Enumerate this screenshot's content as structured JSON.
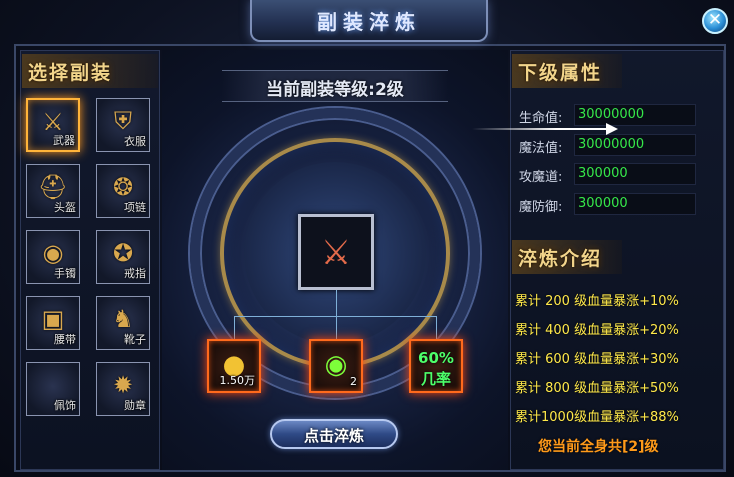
{
  "title": "副装淬炼",
  "close_icon": "close-icon",
  "left_panel": {
    "header": "选择副装",
    "slots": [
      {
        "label": "武器",
        "icon": "sword-icon",
        "glyph": "⚔",
        "selected": true
      },
      {
        "label": "衣服",
        "icon": "armor-icon",
        "glyph": "⛨",
        "selected": false
      },
      {
        "label": "头盔",
        "icon": "helmet-icon",
        "glyph": "⛑",
        "selected": false
      },
      {
        "label": "项链",
        "icon": "necklace-icon",
        "glyph": "❂",
        "selected": false
      },
      {
        "label": "手镯",
        "icon": "bracelet-icon",
        "glyph": "◉",
        "selected": false
      },
      {
        "label": "戒指",
        "icon": "ring-icon",
        "glyph": "✪",
        "selected": false
      },
      {
        "label": "腰带",
        "icon": "belt-icon",
        "glyph": "▣",
        "selected": false
      },
      {
        "label": "靴子",
        "icon": "boots-icon",
        "glyph": "♞",
        "selected": false
      },
      {
        "label": "佩饰",
        "icon": "accessory-icon",
        "glyph": "",
        "selected": false
      },
      {
        "label": "勋章",
        "icon": "medal-icon",
        "glyph": "✹",
        "selected": false
      }
    ]
  },
  "center": {
    "level_text": "当前副装等级:2级",
    "main_item_icon": "sword-icon",
    "materials": {
      "gold_amount": "1.50万",
      "gem_amount": "2",
      "rate_percent": "60%",
      "rate_label": "几率"
    },
    "refine_button": "点击淬炼"
  },
  "right_panel": {
    "attr_header": "下级属性",
    "attributes": [
      {
        "label": "生命值:",
        "value": "30000000"
      },
      {
        "label": "魔法值:",
        "value": "30000000"
      },
      {
        "label": "攻魔道:",
        "value": "300000"
      },
      {
        "label": "魔防御:",
        "value": "300000"
      }
    ],
    "intro_header": "淬炼介绍",
    "intro_lines": [
      "累计 200 级血量暴涨+10%",
      "累计 400 级血量暴涨+20%",
      "累计 600 级血量暴涨+30%",
      "累计 800 级血量暴涨+50%",
      "累计1000级血量暴涨+88%"
    ],
    "total_line": "您当前全身共[2]级"
  },
  "colors": {
    "accent_gold": "#f3d58b",
    "value_green": "#36e84a",
    "intro_yellow": "#ffe94a",
    "total_orange": "#ff9a1a",
    "highlight_orange": "#ff6a1c"
  }
}
